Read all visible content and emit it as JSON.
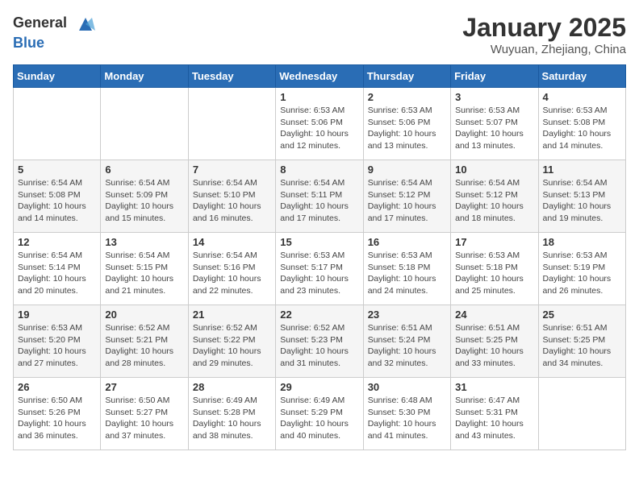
{
  "logo": {
    "general": "General",
    "blue": "Blue"
  },
  "header": {
    "month": "January 2025",
    "location": "Wuyuan, Zhejiang, China"
  },
  "days_of_week": [
    "Sunday",
    "Monday",
    "Tuesday",
    "Wednesday",
    "Thursday",
    "Friday",
    "Saturday"
  ],
  "weeks": [
    [
      {
        "day": "",
        "info": ""
      },
      {
        "day": "",
        "info": ""
      },
      {
        "day": "",
        "info": ""
      },
      {
        "day": "1",
        "info": "Sunrise: 6:53 AM\nSunset: 5:06 PM\nDaylight: 10 hours\nand 12 minutes."
      },
      {
        "day": "2",
        "info": "Sunrise: 6:53 AM\nSunset: 5:06 PM\nDaylight: 10 hours\nand 13 minutes."
      },
      {
        "day": "3",
        "info": "Sunrise: 6:53 AM\nSunset: 5:07 PM\nDaylight: 10 hours\nand 13 minutes."
      },
      {
        "day": "4",
        "info": "Sunrise: 6:53 AM\nSunset: 5:08 PM\nDaylight: 10 hours\nand 14 minutes."
      }
    ],
    [
      {
        "day": "5",
        "info": "Sunrise: 6:54 AM\nSunset: 5:08 PM\nDaylight: 10 hours\nand 14 minutes."
      },
      {
        "day": "6",
        "info": "Sunrise: 6:54 AM\nSunset: 5:09 PM\nDaylight: 10 hours\nand 15 minutes."
      },
      {
        "day": "7",
        "info": "Sunrise: 6:54 AM\nSunset: 5:10 PM\nDaylight: 10 hours\nand 16 minutes."
      },
      {
        "day": "8",
        "info": "Sunrise: 6:54 AM\nSunset: 5:11 PM\nDaylight: 10 hours\nand 17 minutes."
      },
      {
        "day": "9",
        "info": "Sunrise: 6:54 AM\nSunset: 5:12 PM\nDaylight: 10 hours\nand 17 minutes."
      },
      {
        "day": "10",
        "info": "Sunrise: 6:54 AM\nSunset: 5:12 PM\nDaylight: 10 hours\nand 18 minutes."
      },
      {
        "day": "11",
        "info": "Sunrise: 6:54 AM\nSunset: 5:13 PM\nDaylight: 10 hours\nand 19 minutes."
      }
    ],
    [
      {
        "day": "12",
        "info": "Sunrise: 6:54 AM\nSunset: 5:14 PM\nDaylight: 10 hours\nand 20 minutes."
      },
      {
        "day": "13",
        "info": "Sunrise: 6:54 AM\nSunset: 5:15 PM\nDaylight: 10 hours\nand 21 minutes."
      },
      {
        "day": "14",
        "info": "Sunrise: 6:54 AM\nSunset: 5:16 PM\nDaylight: 10 hours\nand 22 minutes."
      },
      {
        "day": "15",
        "info": "Sunrise: 6:53 AM\nSunset: 5:17 PM\nDaylight: 10 hours\nand 23 minutes."
      },
      {
        "day": "16",
        "info": "Sunrise: 6:53 AM\nSunset: 5:18 PM\nDaylight: 10 hours\nand 24 minutes."
      },
      {
        "day": "17",
        "info": "Sunrise: 6:53 AM\nSunset: 5:18 PM\nDaylight: 10 hours\nand 25 minutes."
      },
      {
        "day": "18",
        "info": "Sunrise: 6:53 AM\nSunset: 5:19 PM\nDaylight: 10 hours\nand 26 minutes."
      }
    ],
    [
      {
        "day": "19",
        "info": "Sunrise: 6:53 AM\nSunset: 5:20 PM\nDaylight: 10 hours\nand 27 minutes."
      },
      {
        "day": "20",
        "info": "Sunrise: 6:52 AM\nSunset: 5:21 PM\nDaylight: 10 hours\nand 28 minutes."
      },
      {
        "day": "21",
        "info": "Sunrise: 6:52 AM\nSunset: 5:22 PM\nDaylight: 10 hours\nand 29 minutes."
      },
      {
        "day": "22",
        "info": "Sunrise: 6:52 AM\nSunset: 5:23 PM\nDaylight: 10 hours\nand 31 minutes."
      },
      {
        "day": "23",
        "info": "Sunrise: 6:51 AM\nSunset: 5:24 PM\nDaylight: 10 hours\nand 32 minutes."
      },
      {
        "day": "24",
        "info": "Sunrise: 6:51 AM\nSunset: 5:25 PM\nDaylight: 10 hours\nand 33 minutes."
      },
      {
        "day": "25",
        "info": "Sunrise: 6:51 AM\nSunset: 5:25 PM\nDaylight: 10 hours\nand 34 minutes."
      }
    ],
    [
      {
        "day": "26",
        "info": "Sunrise: 6:50 AM\nSunset: 5:26 PM\nDaylight: 10 hours\nand 36 minutes."
      },
      {
        "day": "27",
        "info": "Sunrise: 6:50 AM\nSunset: 5:27 PM\nDaylight: 10 hours\nand 37 minutes."
      },
      {
        "day": "28",
        "info": "Sunrise: 6:49 AM\nSunset: 5:28 PM\nDaylight: 10 hours\nand 38 minutes."
      },
      {
        "day": "29",
        "info": "Sunrise: 6:49 AM\nSunset: 5:29 PM\nDaylight: 10 hours\nand 40 minutes."
      },
      {
        "day": "30",
        "info": "Sunrise: 6:48 AM\nSunset: 5:30 PM\nDaylight: 10 hours\nand 41 minutes."
      },
      {
        "day": "31",
        "info": "Sunrise: 6:47 AM\nSunset: 5:31 PM\nDaylight: 10 hours\nand 43 minutes."
      },
      {
        "day": "",
        "info": ""
      }
    ]
  ]
}
